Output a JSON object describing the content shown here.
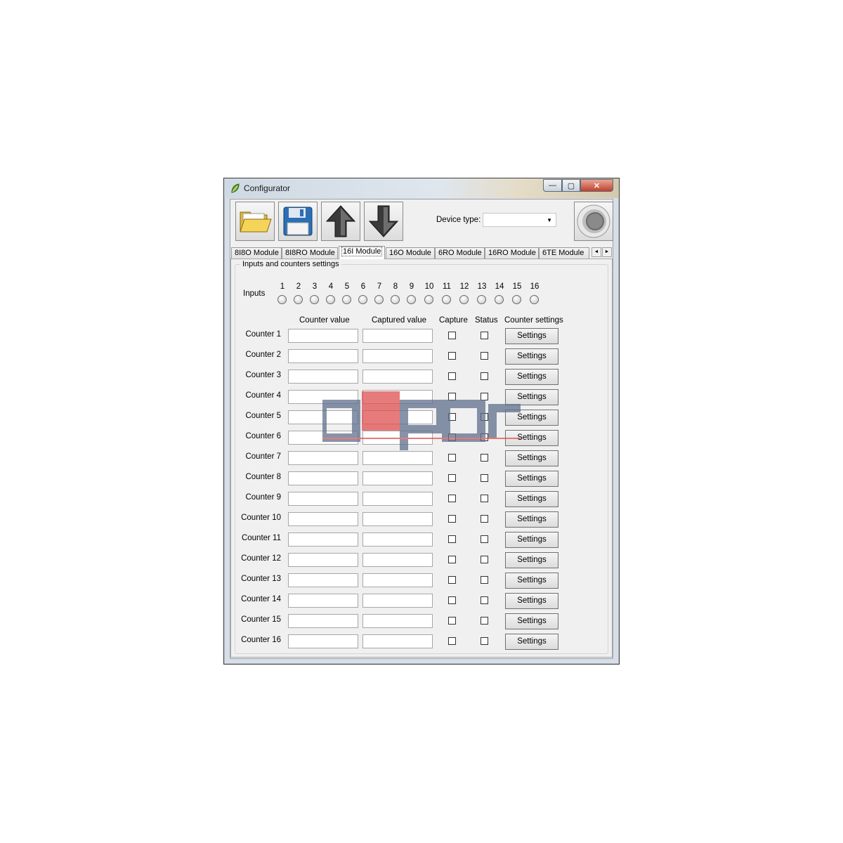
{
  "window": {
    "title": "Configurator",
    "minimize": "—",
    "maximize": "▢",
    "close": "✕"
  },
  "toolbar": {
    "device_type_label": "Device type:",
    "device_type_value": ""
  },
  "tabs": [
    {
      "label": "8I8O Module",
      "active": false
    },
    {
      "label": "8I8RO Module",
      "active": false
    },
    {
      "label": "16I Module",
      "active": true
    },
    {
      "label": "16O Module",
      "active": false
    },
    {
      "label": "6RO Module",
      "active": false
    },
    {
      "label": "16RO Module",
      "active": false
    },
    {
      "label": "6TE Module",
      "active": false
    }
  ],
  "tab_scroll": {
    "left": "◄",
    "right": "►"
  },
  "group": {
    "title": "Inputs and counters settings"
  },
  "inputs": {
    "label": "Inputs",
    "numbers": [
      "1",
      "2",
      "3",
      "4",
      "5",
      "6",
      "7",
      "8",
      "9",
      "10",
      "11",
      "12",
      "13",
      "14",
      "15",
      "16"
    ]
  },
  "headers": {
    "counter_value": "Counter value",
    "captured_value": "Captured value",
    "capture": "Capture",
    "status": "Status",
    "counter_settings": "Counter settings"
  },
  "counters": [
    {
      "label": "Counter 1",
      "button": "Settings"
    },
    {
      "label": "Counter 2",
      "button": "Settings"
    },
    {
      "label": "Counter 3",
      "button": "Settings"
    },
    {
      "label": "Counter 4",
      "button": "Settings"
    },
    {
      "label": "Counter 5",
      "button": "Settings"
    },
    {
      "label": "Counter 6",
      "button": "Settings"
    },
    {
      "label": "Counter 7",
      "button": "Settings"
    },
    {
      "label": "Counter 8",
      "button": "Settings"
    },
    {
      "label": "Counter 9",
      "button": "Settings"
    },
    {
      "label": "Counter 10",
      "button": "Settings"
    },
    {
      "label": "Counter 11",
      "button": "Settings"
    },
    {
      "label": "Counter 12",
      "button": "Settings"
    },
    {
      "label": "Counter 13",
      "button": "Settings"
    },
    {
      "label": "Counter 14",
      "button": "Settings"
    },
    {
      "label": "Counter 15",
      "button": "Settings"
    },
    {
      "label": "Counter 16",
      "button": "Settings"
    }
  ],
  "watermark": {
    "text": "aspar"
  },
  "colors": {
    "watermark_gray": "#5f6f8c",
    "watermark_red": "#e05050",
    "close_red": "#c0412c"
  },
  "icons": [
    "app-leaf-icon",
    "open-folder-icon",
    "save-disk-icon",
    "upload-arrow-icon",
    "download-arrow-icon",
    "connect-round-icon"
  ]
}
